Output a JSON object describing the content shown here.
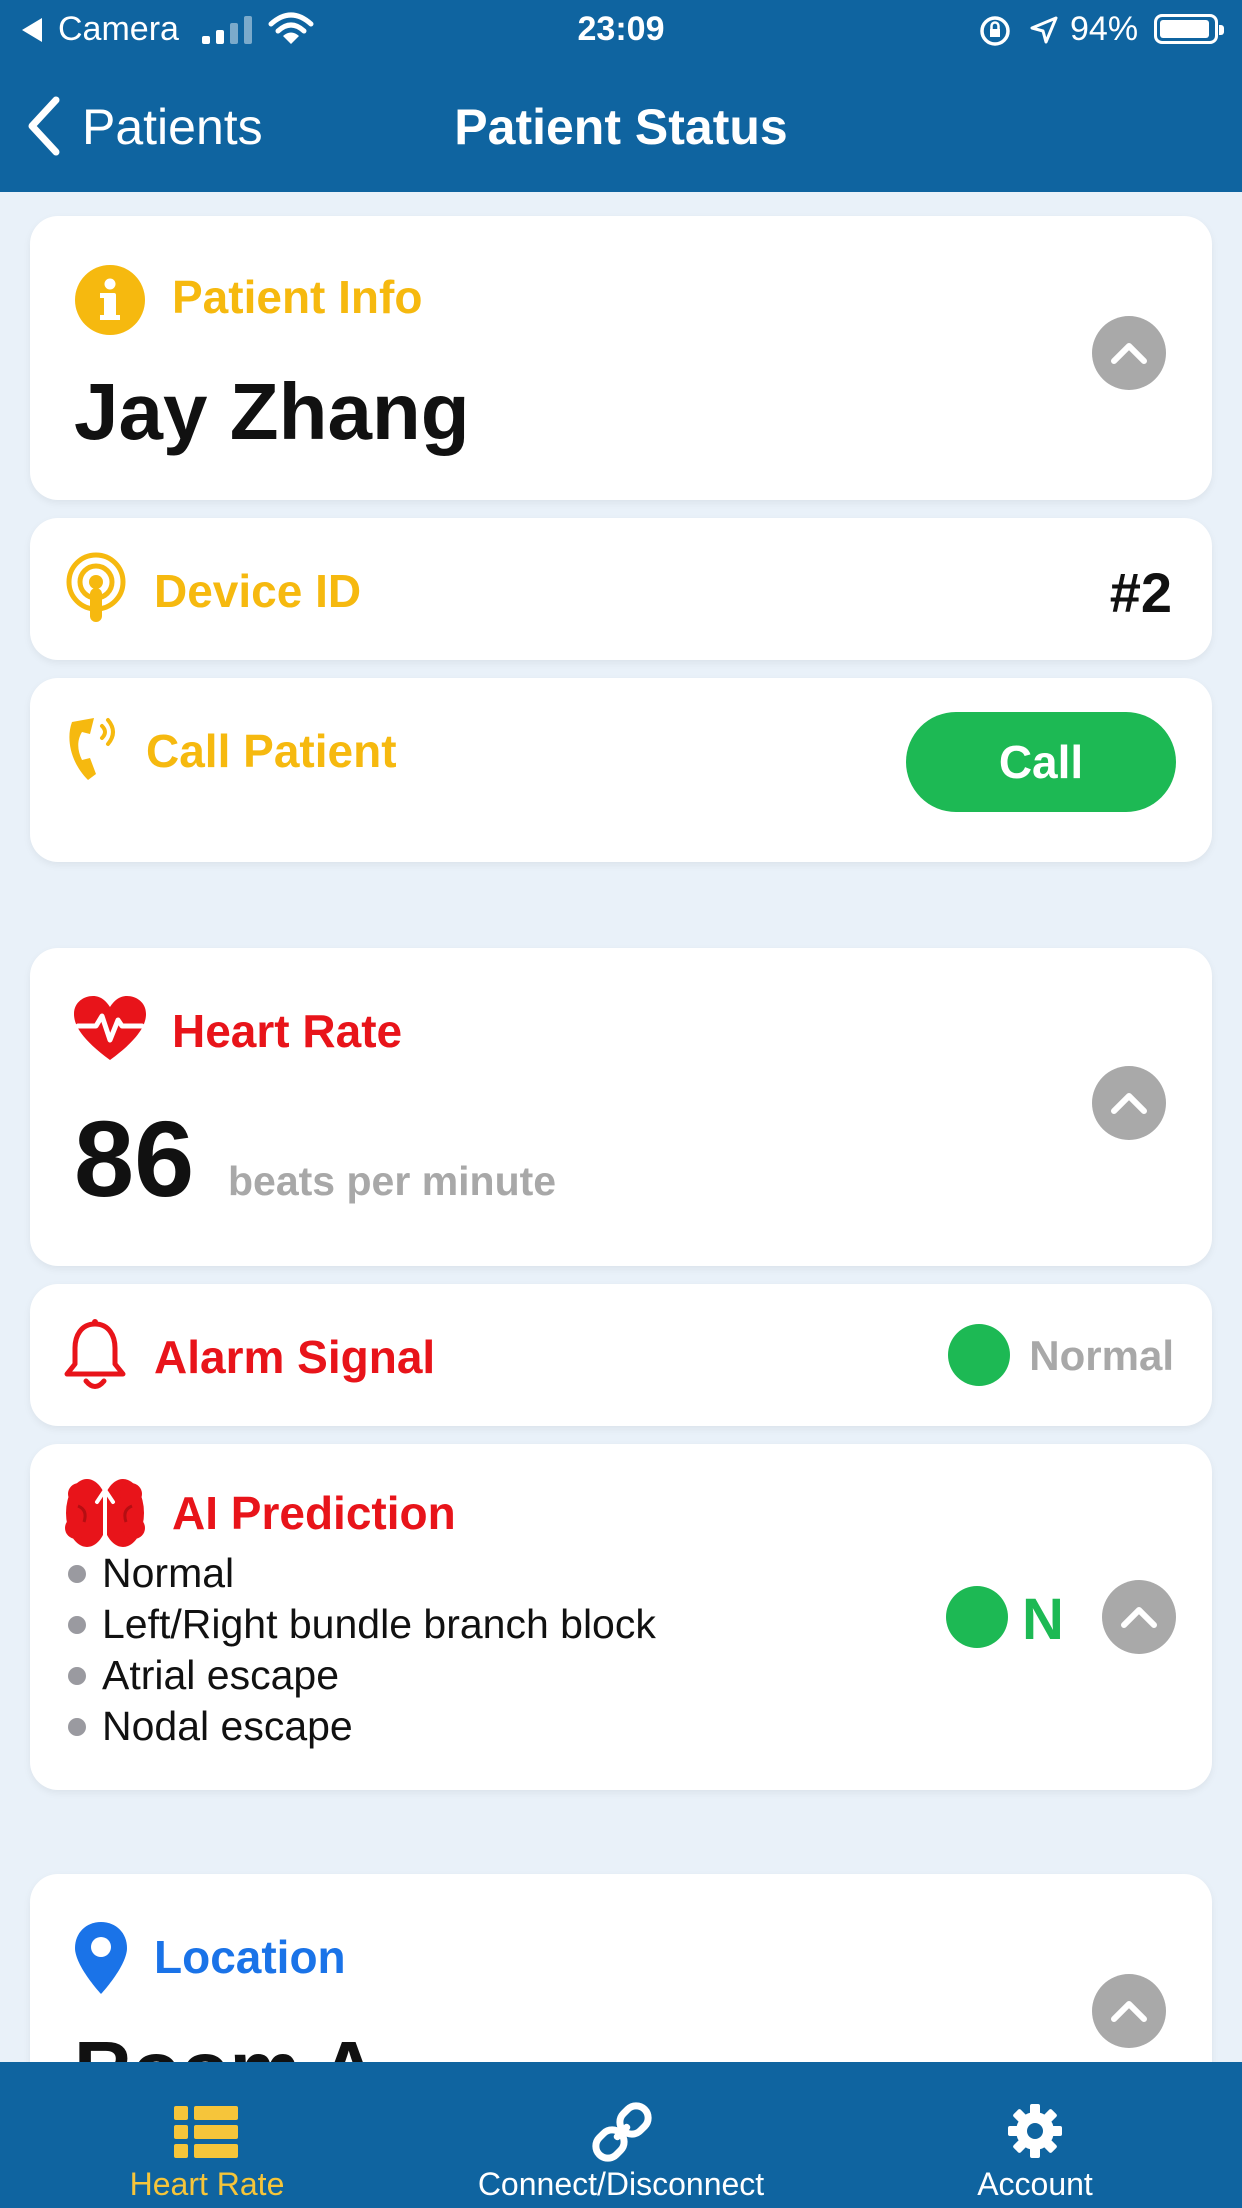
{
  "status_bar": {
    "back_app": "Camera",
    "time": "23:09",
    "battery": "94%",
    "battery_level": 0.94
  },
  "nav": {
    "back_label": "Patients",
    "title": "Patient Status"
  },
  "patient_info": {
    "title": "Patient Info",
    "name": "Jay Zhang"
  },
  "device": {
    "title": "Device ID",
    "value": "#2"
  },
  "call": {
    "title": "Call Patient",
    "button_label": "Call"
  },
  "heart_rate": {
    "title": "Heart Rate",
    "value": "86",
    "unit": "beats per minute"
  },
  "alarm": {
    "title": "Alarm Signal",
    "status": "Normal"
  },
  "ai_prediction": {
    "title": "AI Prediction",
    "items": [
      "Normal",
      "Left/Right bundle branch block",
      "Atrial escape",
      "Nodal escape"
    ],
    "result": "N"
  },
  "location": {
    "title": "Location",
    "value": "Room A"
  },
  "tabs": [
    {
      "label": "Heart Rate",
      "icon": "list-icon",
      "active": true
    },
    {
      "label": "Connect/Disconnect",
      "icon": "link-icon",
      "active": false
    },
    {
      "label": "Account",
      "icon": "gear-icon",
      "active": false
    }
  ],
  "colors": {
    "header": "#0f64a0",
    "orange": "#f6b90f",
    "red": "#e8141a",
    "blue": "#1a73e8",
    "green": "#1db954",
    "active_tab": "#f6c53a"
  }
}
